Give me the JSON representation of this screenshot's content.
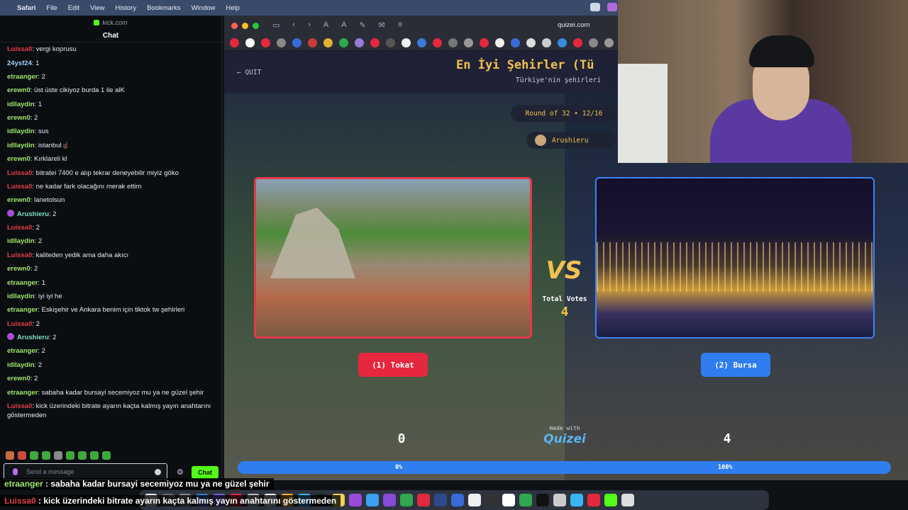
{
  "menubar": {
    "app": "Safari",
    "items": [
      "File",
      "Edit",
      "View",
      "History",
      "Bookmarks",
      "Window",
      "Help"
    ]
  },
  "chat": {
    "tab_url": "kick.com",
    "title": "Chat",
    "messages": [
      {
        "user": "Luissa0",
        "color": "#e0404a",
        "text": "vergi koprusu",
        "badge": false
      },
      {
        "user": "24ysf24",
        "color": "#9fd4ff",
        "text": "1",
        "badge": false
      },
      {
        "user": "etraanger",
        "color": "#9fe870",
        "text": "2",
        "badge": false
      },
      {
        "user": "erewn0",
        "color": "#9fe870",
        "text": "üst üste cikiyoz burda 1 ile alK",
        "badge": false
      },
      {
        "user": "idllaydin",
        "color": "#9fe870",
        "text": "1",
        "badge": false
      },
      {
        "user": "erewn0",
        "color": "#9fe870",
        "text": "2",
        "badge": false
      },
      {
        "user": "idllaydin",
        "color": "#9fe870",
        "text": "sus",
        "badge": false
      },
      {
        "user": "idllaydin",
        "color": "#9fe870",
        "text": "istanbul☝🏿",
        "badge": false
      },
      {
        "user": "erewn0",
        "color": "#9fe870",
        "text": "Kırklareli kl",
        "badge": false
      },
      {
        "user": "Luissa0",
        "color": "#e0404a",
        "text": "bitratei 7400 e alıp tekrar deneyebilir miyiz göko",
        "badge": false
      },
      {
        "user": "Luissa0",
        "color": "#e0404a",
        "text": "ne kadar fark olacağını merak ettim",
        "badge": false
      },
      {
        "user": "erewn0",
        "color": "#9fe870",
        "text": "lanetolsun",
        "badge": false
      },
      {
        "user": "Arushieru",
        "color": "#7ee0c0",
        "text": "2",
        "badge": true
      },
      {
        "user": "Luissa0",
        "color": "#e0404a",
        "text": "2",
        "badge": false
      },
      {
        "user": "idllaydin",
        "color": "#9fe870",
        "text": "2",
        "badge": false
      },
      {
        "user": "Luissa0",
        "color": "#e0404a",
        "text": "kaliteden yedik ama daha akıcı",
        "badge": false
      },
      {
        "user": "erewn0",
        "color": "#9fe870",
        "text": "2",
        "badge": false
      },
      {
        "user": "etraanger",
        "color": "#9fe870",
        "text": "1",
        "badge": false
      },
      {
        "user": "idllaydin",
        "color": "#9fe870",
        "text": "iyi iyi he",
        "badge": false
      },
      {
        "user": "etraanger",
        "color": "#9fe870",
        "text": "Eskişehir ve Ankara benim için tiktok tw şehirleri",
        "badge": false
      },
      {
        "user": "Luissa0",
        "color": "#e0404a",
        "text": "2",
        "badge": false
      },
      {
        "user": "Arushieru",
        "color": "#7ee0c0",
        "text": "2",
        "badge": true
      },
      {
        "user": "etraanger",
        "color": "#9fe870",
        "text": "2",
        "badge": false
      },
      {
        "user": "idllaydin",
        "color": "#9fe870",
        "text": "2",
        "badge": false
      },
      {
        "user": "erewn0",
        "color": "#9fe870",
        "text": "2",
        "badge": false
      },
      {
        "user": "etraanger",
        "color": "#9fe870",
        "text": "sabaha kadar bursayi secemiyoz mu ya ne güzel şehir",
        "badge": false
      },
      {
        "user": "Luissa0",
        "color": "#e0404a",
        "text": "kick üzerindeki bitrate ayarın kaçta kalmış yayın anahtarını göstermeden",
        "badge": false
      }
    ],
    "input_placeholder": "Send a message",
    "send_label": "Chat"
  },
  "browser": {
    "url": "quizei.com"
  },
  "quiz": {
    "quit_label": "QUIT",
    "title": "En İyi Şehirler (Tü",
    "subtitle": "Türkiye'nin şehirleri",
    "round": "Round of 32 • 12/16",
    "player": "Arushieru",
    "vs": "VS",
    "total_votes_label": "Total Votes",
    "total_votes": "4",
    "left": {
      "label": "(1) Tokat",
      "score": "0",
      "percent": "0%"
    },
    "right": {
      "label": "(2) Bursa",
      "score": "4",
      "percent": "100%"
    },
    "left_share": 0.0,
    "made_with": "made with",
    "brand": "Quizei"
  },
  "overlay": {
    "line1_user": "etraanger",
    "line1_text": "sabaha kadar bursayi secemiyoz mu ya ne güzel şehir",
    "line2_user": "Luissa0",
    "line2_text": "kick üzerindeki bitrate ayarın kaçta kalmış yayın anahtarını göstermeden"
  },
  "colors": {
    "accent_yellow": "#f2c14e",
    "left_red": "#e5283e",
    "right_blue": "#2f7df0",
    "kick_green": "#53fc18"
  }
}
